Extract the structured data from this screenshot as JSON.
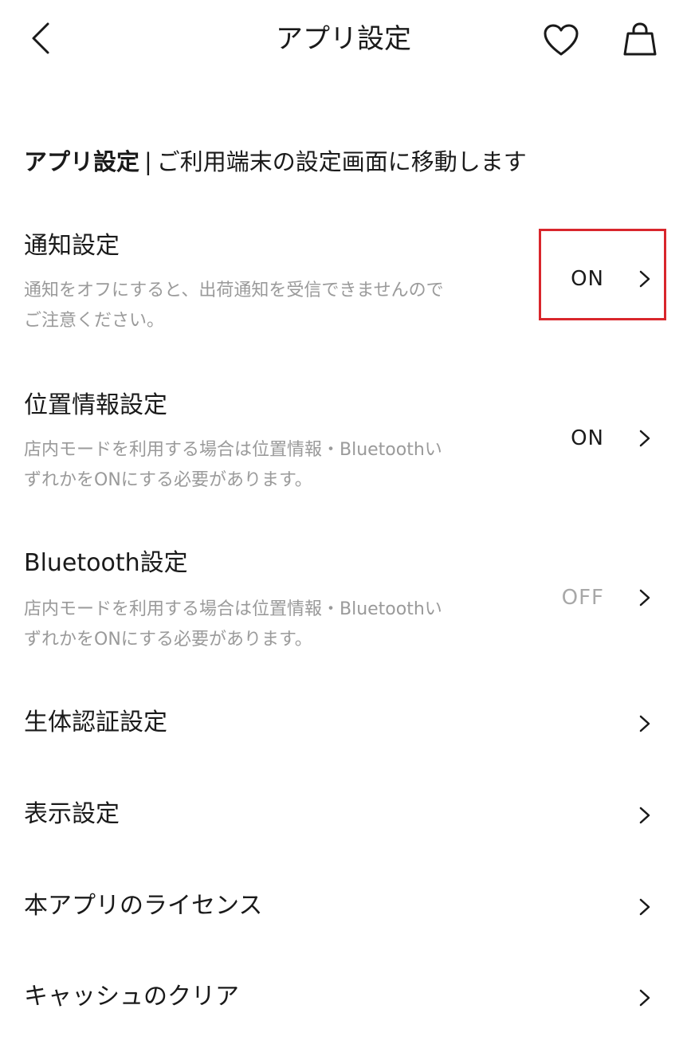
{
  "header": {
    "title": "アプリ設定",
    "back_icon": "chevron-left-icon",
    "favorite_icon": "heart-icon",
    "cart_icon": "shopping-bag-icon"
  },
  "section": {
    "heading_strong": "アプリ設定",
    "separator": "|",
    "heading_rest": "ご利用端末の設定画面に移動します"
  },
  "settings": [
    {
      "title": "通知設定",
      "desc_line1": "通知をオフにすると、出荷通知を受信できませんので",
      "desc_line2": "ご注意ください。",
      "value": "ON"
    },
    {
      "title": "位置情報設定",
      "desc_line1": "店内モードを利用する場合は位置情報・Bluetoothい",
      "desc_line2": "ずれかをONにする必要があります。",
      "value": "ON"
    },
    {
      "title": "Bluetooth設定",
      "desc_line1": "店内モードを利用する場合は位置情報・Bluetoothい",
      "desc_line2": "ずれかをONにする必要があります。",
      "value": "OFF"
    },
    {
      "title": "生体認証設定"
    },
    {
      "title": "表示設定"
    },
    {
      "title": "本アプリのライセンス"
    },
    {
      "title": "キャッシュのクリア"
    }
  ],
  "colors": {
    "text": "#1a1a1a",
    "muted": "#9a9a9a",
    "off": "#a8a8a8",
    "highlight": "#d9262c"
  }
}
